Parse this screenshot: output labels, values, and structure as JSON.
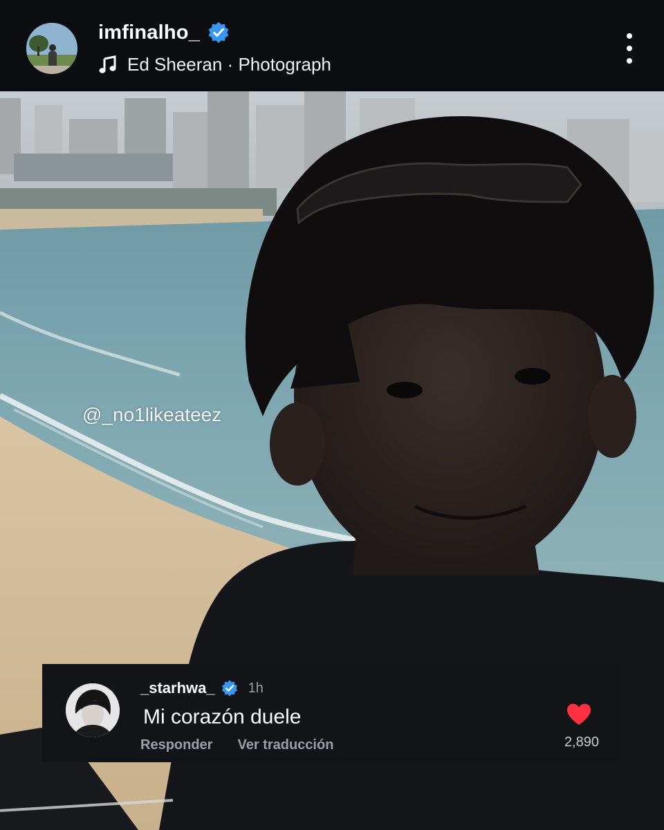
{
  "header": {
    "username": "imfinalho_",
    "verified_icon": "verified-badge-icon",
    "music_artist": "Ed Sheeran",
    "music_separator": " · ",
    "music_title": "Photograph",
    "more_icon": "more-vertical-icon"
  },
  "photo": {
    "watermark": "@_no1likeateez"
  },
  "comment": {
    "username": "_starhwa_",
    "time": "1h",
    "text": "Mi corazón duele",
    "reply_label": "Responder",
    "translate_label": "Ver traducción",
    "like_count": "2,890",
    "like_icon": "heart-icon"
  },
  "colors": {
    "header_bg": "#0b0d10",
    "comment_bg": "#121418",
    "verified": "#3897f0",
    "heart": "#ff3040",
    "secondary_text": "#9aa0a6"
  }
}
